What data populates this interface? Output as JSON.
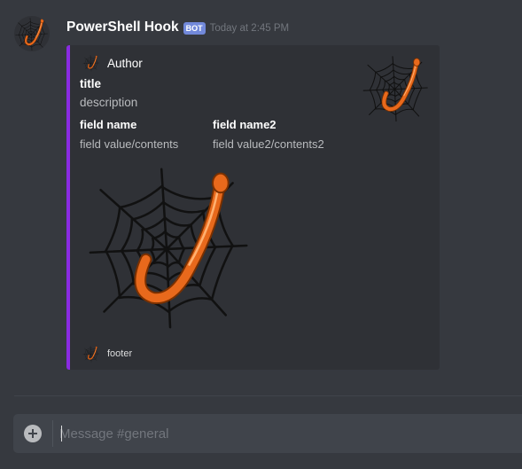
{
  "message": {
    "username": "PowerShell Hook",
    "bot_tag": "BOT",
    "timestamp": "Today at 2:45 PM",
    "avatar_icon": "spiderweb-hook-icon"
  },
  "embed": {
    "accent_color": "#8a2be2",
    "author": {
      "name": "Author",
      "icon": "spiderweb-hook-icon"
    },
    "title": "title",
    "description": "description",
    "thumbnail_icon": "spiderweb-hook-icon",
    "fields": [
      {
        "name": "field name",
        "value": "field value/contents"
      },
      {
        "name": "field name2",
        "value": "field value2/contents2"
      }
    ],
    "image_icon": "spiderweb-hook-icon",
    "footer": {
      "text": "footer",
      "icon": "spiderweb-hook-icon"
    }
  },
  "composer": {
    "placeholder": "Message #general",
    "value": "",
    "attach_icon": "plus-circle-icon"
  },
  "colors": {
    "background": "#36393f",
    "embed_background": "#2f3136",
    "bot_tag": "#7289da",
    "hook": "#e8691c"
  }
}
